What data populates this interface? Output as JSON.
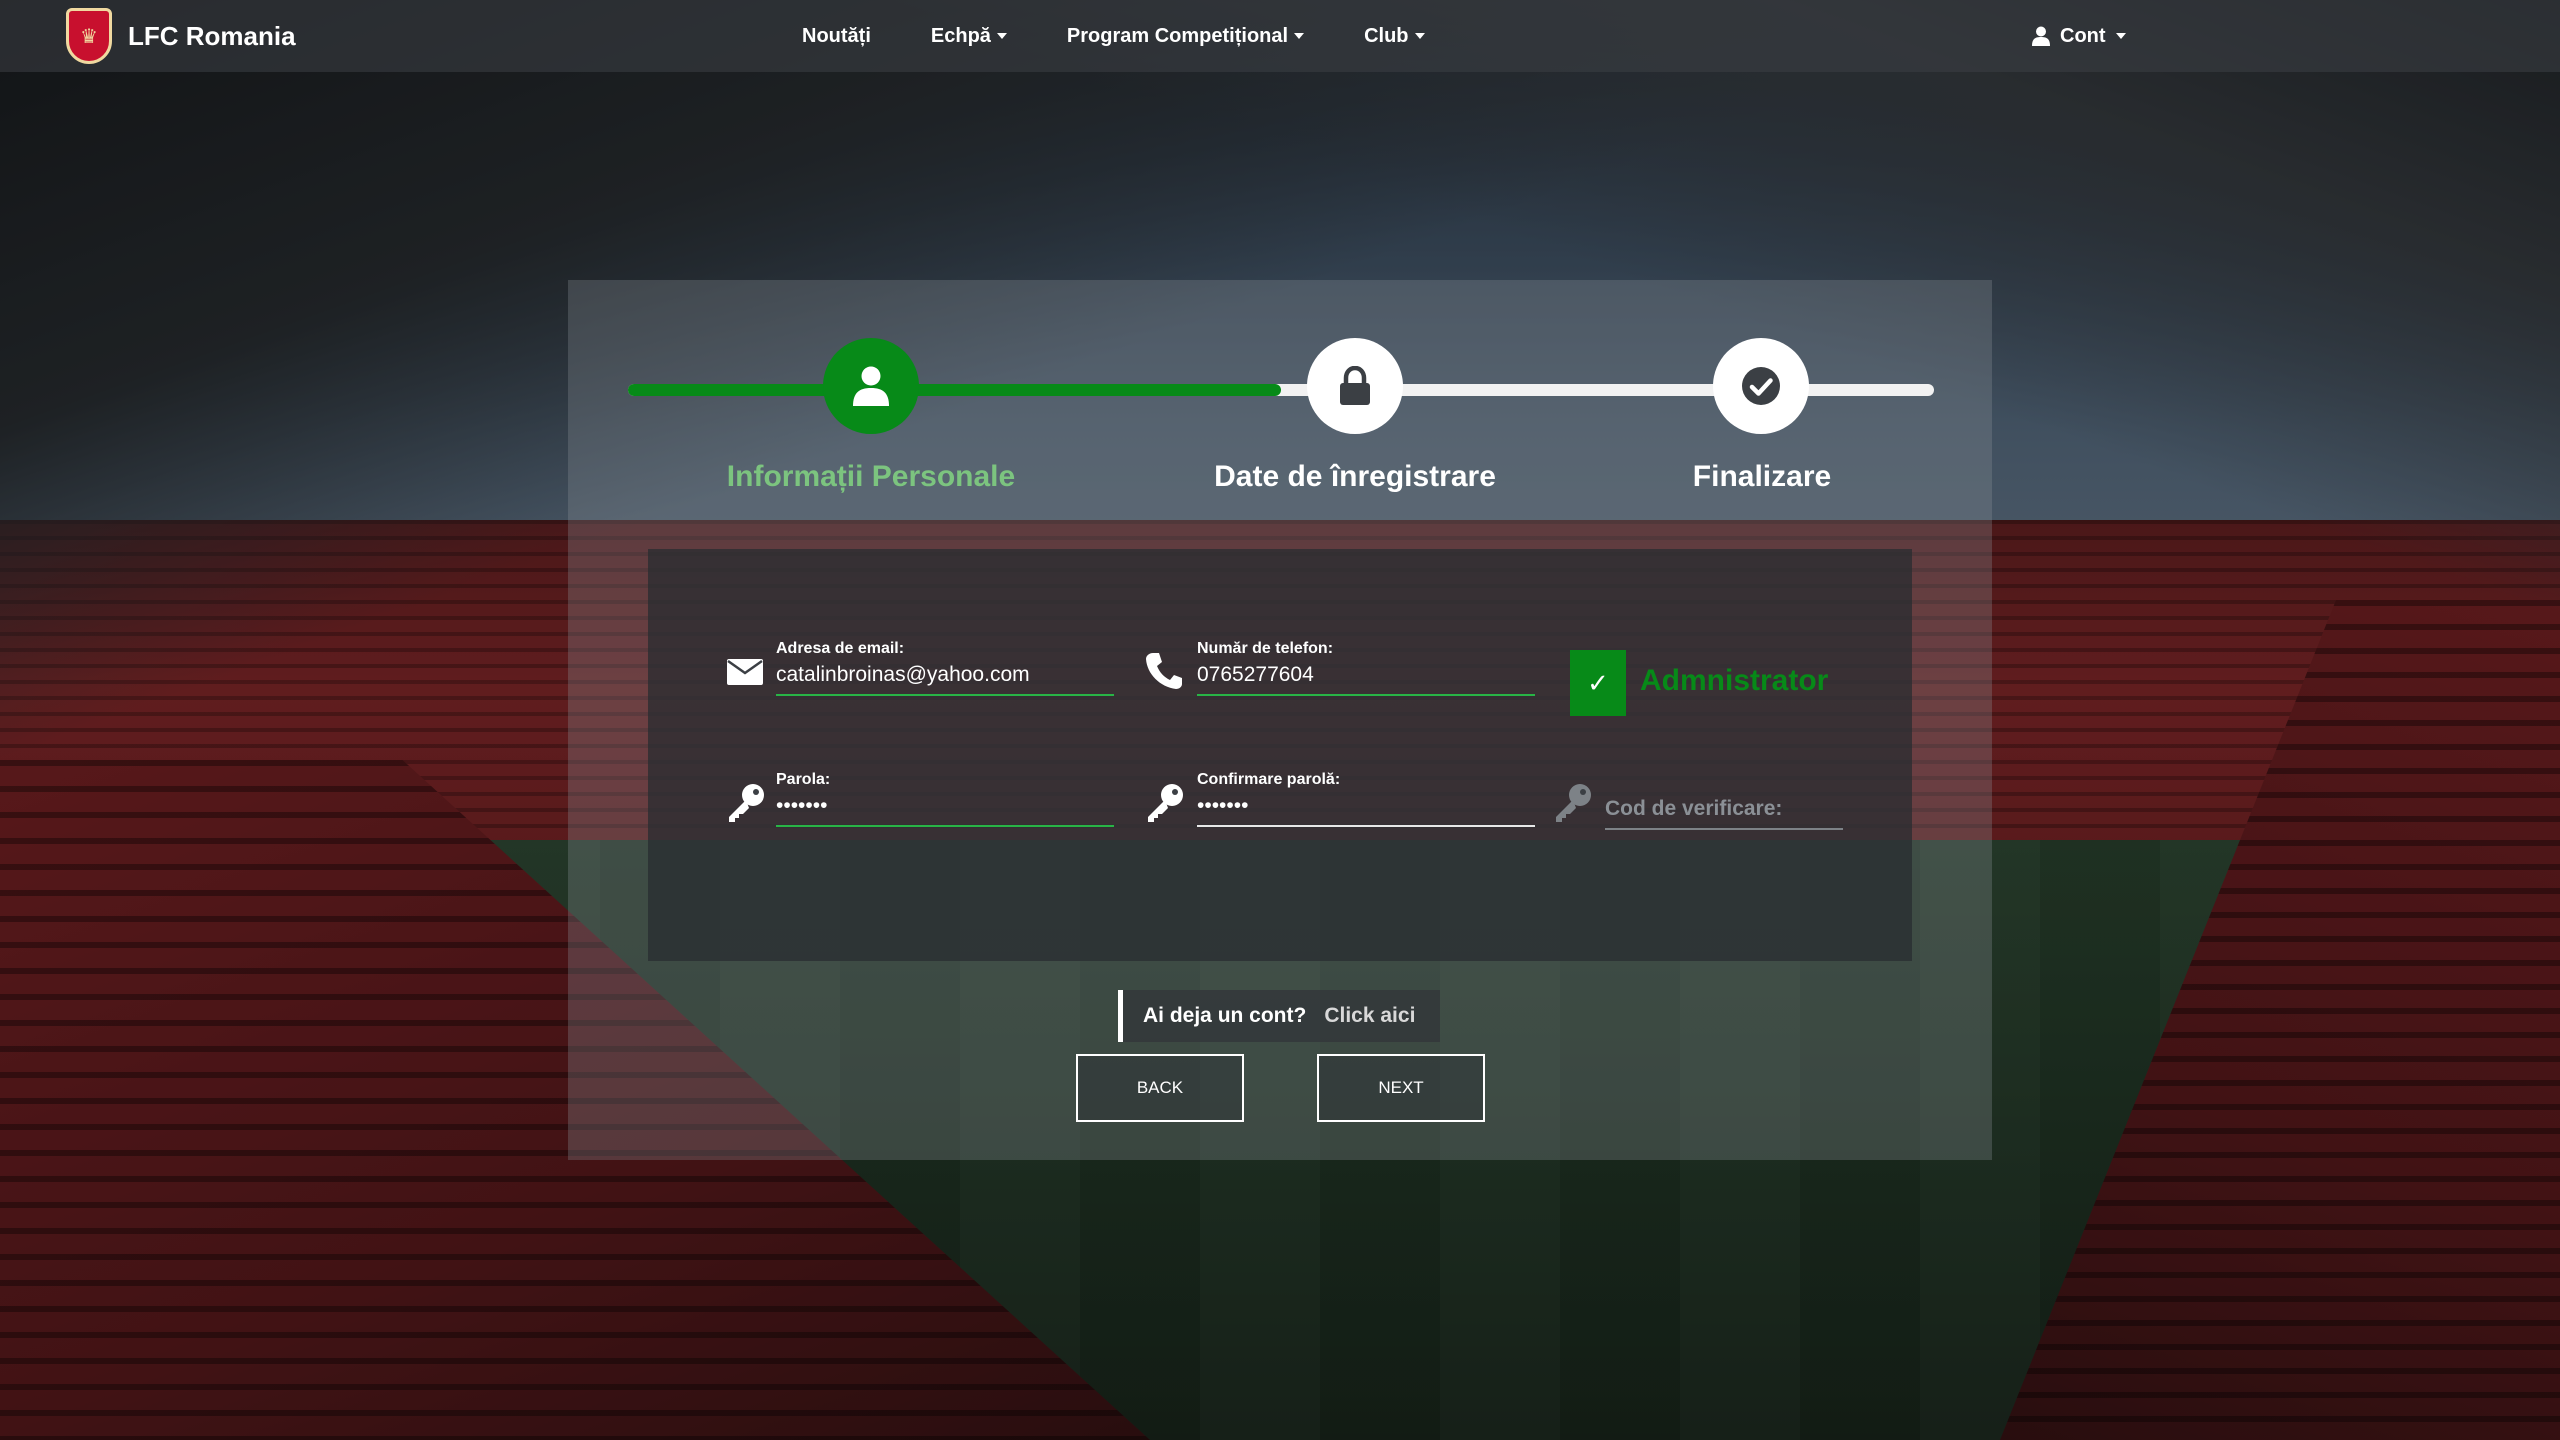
{
  "navbar": {
    "brand": "LFC Romania",
    "links": [
      {
        "label": "Noutăți",
        "dropdown": false
      },
      {
        "label": "Echpă",
        "dropdown": true
      },
      {
        "label": "Program Competițional",
        "dropdown": true
      },
      {
        "label": "Club",
        "dropdown": true
      }
    ],
    "account_label": "Cont"
  },
  "wizard": {
    "steps": [
      {
        "label": "Informații Personale",
        "icon": "user-icon",
        "state": "active"
      },
      {
        "label": "Date de înregistrare",
        "icon": "lock-icon",
        "state": "pending"
      },
      {
        "label": "Finalizare",
        "icon": "check-circle-icon",
        "state": "pending"
      }
    ],
    "progress_fraction": 0.5
  },
  "form": {
    "email": {
      "label": "Adresa de email:",
      "value": "catalinbroinas@yahoo.com"
    },
    "phone": {
      "label": "Număr de telefon:",
      "value": "0765277604"
    },
    "admin": {
      "label": "Admnistrator",
      "checked": true
    },
    "password": {
      "label": "Parola:",
      "value": "•••••••"
    },
    "password_confirm": {
      "label": "Confirmare parolă:",
      "value": "•••••••"
    },
    "verification_code": {
      "placeholder": "Cod de verificare:",
      "value": ""
    }
  },
  "login_hint": {
    "question": "Ai deja un cont?",
    "link": "Click aici"
  },
  "buttons": {
    "back": "BACK",
    "next": "NEXT"
  },
  "colors": {
    "accent_green": "#078a18",
    "active_label": "#7cc47f",
    "input_underline": "#28b446"
  }
}
